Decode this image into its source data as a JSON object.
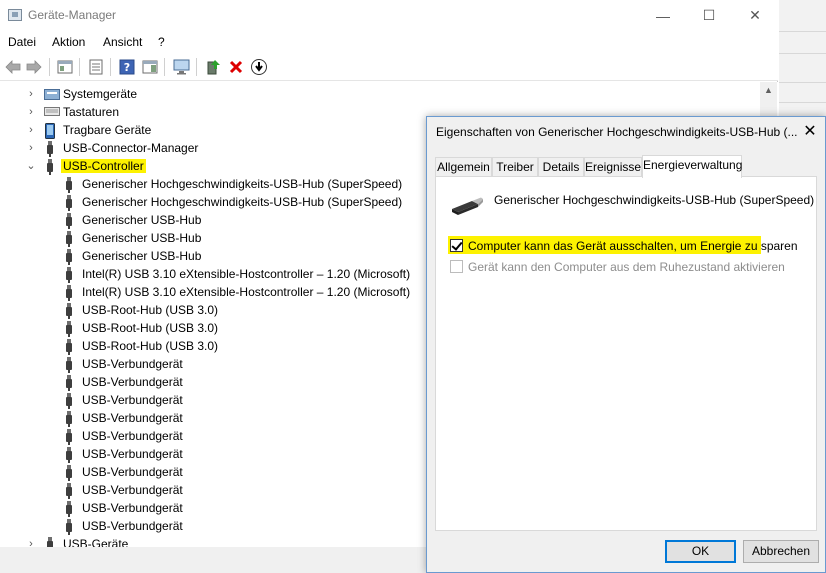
{
  "window": {
    "title": "Geräte-Manager",
    "controls": {
      "minimize": "—",
      "maximize": "☐",
      "close": "✕"
    }
  },
  "menu": [
    "Datei",
    "Aktion",
    "Ansicht",
    "?"
  ],
  "toolbar": {
    "icons": [
      "back-icon",
      "forward-icon",
      "show-hide-tree-icon",
      "properties-icon",
      "help-icon",
      "action-pane-icon",
      "monitor-scan-icon",
      "update-driver-icon",
      "uninstall-icon",
      "disable-icon"
    ]
  },
  "tree": {
    "categories_above": [
      {
        "label": "Systemgeräte",
        "icon": "system-device-icon",
        "expanded": false
      },
      {
        "label": "Tastaturen",
        "icon": "keyboard-icon",
        "expanded": false
      },
      {
        "label": "Tragbare Geräte",
        "icon": "portable-device-icon",
        "expanded": false
      },
      {
        "label": "USB-Connector-Manager",
        "icon": "usb-icon",
        "expanded": false
      }
    ],
    "usb_controller": {
      "label": "USB-Controller",
      "icon": "usb-icon",
      "expanded": true,
      "highlight_color": "#fdf200",
      "children": [
        "Generischer Hochgeschwindigkeits-USB-Hub (SuperSpeed)",
        "Generischer Hochgeschwindigkeits-USB-Hub (SuperSpeed)",
        "Generischer USB-Hub",
        "Generischer USB-Hub",
        "Generischer USB-Hub",
        "Intel(R) USB 3.10 eXtensible-Hostcontroller – 1.20 (Microsoft)",
        "Intel(R) USB 3.10 eXtensible-Hostcontroller – 1.20 (Microsoft)",
        "USB-Root-Hub (USB 3.0)",
        "USB-Root-Hub (USB 3.0)",
        "USB-Root-Hub (USB 3.0)",
        "USB-Verbundgerät",
        "USB-Verbundgerät",
        "USB-Verbundgerät",
        "USB-Verbundgerät",
        "USB-Verbundgerät",
        "USB-Verbundgerät",
        "USB-Verbundgerät",
        "USB-Verbundgerät",
        "USB-Verbundgerät",
        "USB-Verbundgerät"
      ]
    },
    "categories_below": [
      {
        "label": "USB-Geräte",
        "icon": "usb-icon",
        "expanded": false
      }
    ]
  },
  "dialog": {
    "title": "Eigenschaften von Generischer Hochgeschwindigkeits-USB-Hub (...",
    "close": "✕",
    "tabs": [
      "Allgemein",
      "Treiber",
      "Details",
      "Ereignisse",
      "Energieverwaltung"
    ],
    "active_tab": "Energieverwaltung",
    "device_name": "Generischer Hochgeschwindigkeits-USB-Hub (SuperSpeed)",
    "options": [
      {
        "label": "Computer kann das Gerät ausschalten, um Energie zu sparen",
        "checked": true,
        "enabled": true,
        "highlight_color": "#fdf200"
      },
      {
        "label": "Gerät kann den Computer aus dem Ruhezustand aktivieren",
        "checked": false,
        "enabled": false
      }
    ],
    "buttons": {
      "ok": "OK",
      "cancel": "Abbrechen"
    }
  },
  "colors": {
    "highlight": "#fdf200",
    "accent": "#0078d7",
    "dialog_bg": "#f0f0f0",
    "disabled_text": "#8d8d8d"
  }
}
